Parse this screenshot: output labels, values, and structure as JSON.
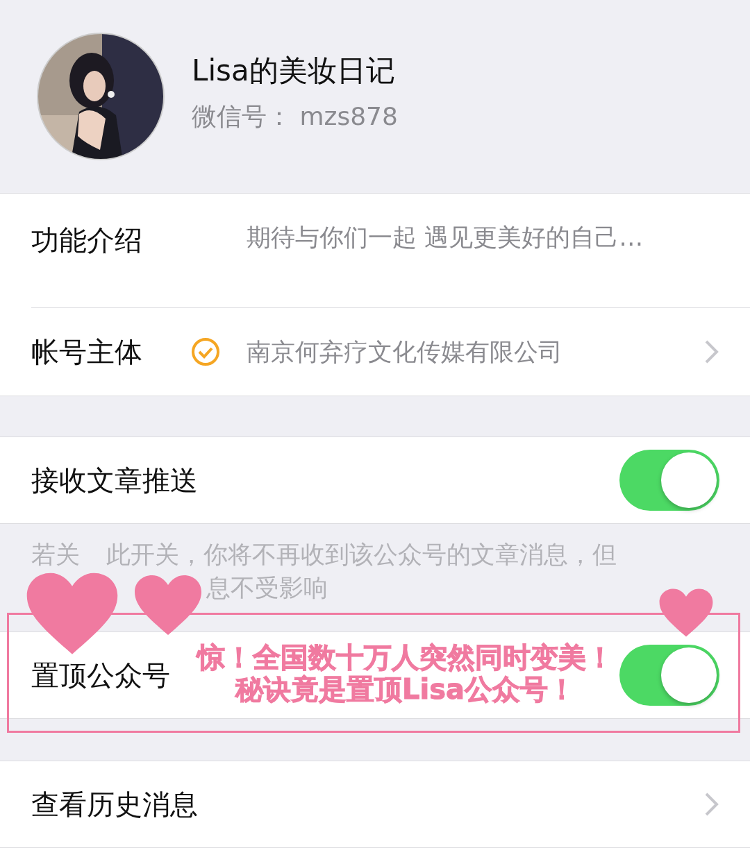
{
  "profile": {
    "name": "Lisa的美妆日记",
    "wechat_id_label": "微信号：",
    "wechat_id": "mzs878"
  },
  "info_rows": [
    {
      "label": "功能介绍",
      "value": "期待与你们一起 遇见更美好的自己…",
      "verified": false,
      "chevron": false
    },
    {
      "label": "帐号主体",
      "value": "南京何弃疗文化传媒有限公司",
      "verified": true,
      "chevron": true
    }
  ],
  "push": {
    "label": "接收文章推送",
    "on": true
  },
  "hint": {
    "line_1": [
      "若关",
      "此开关，你将不再收到该公众号的文章消息，但"
    ],
    "line_2": "息不受影响"
  },
  "pin": {
    "label": "置顶公众号",
    "on": true,
    "banner": [
      "惊！全国数十万人突然同时变美！",
      "秘诀竟是置顶Lisa公众号！"
    ]
  },
  "history": {
    "label": "查看历史消息",
    "chevron": true
  }
}
